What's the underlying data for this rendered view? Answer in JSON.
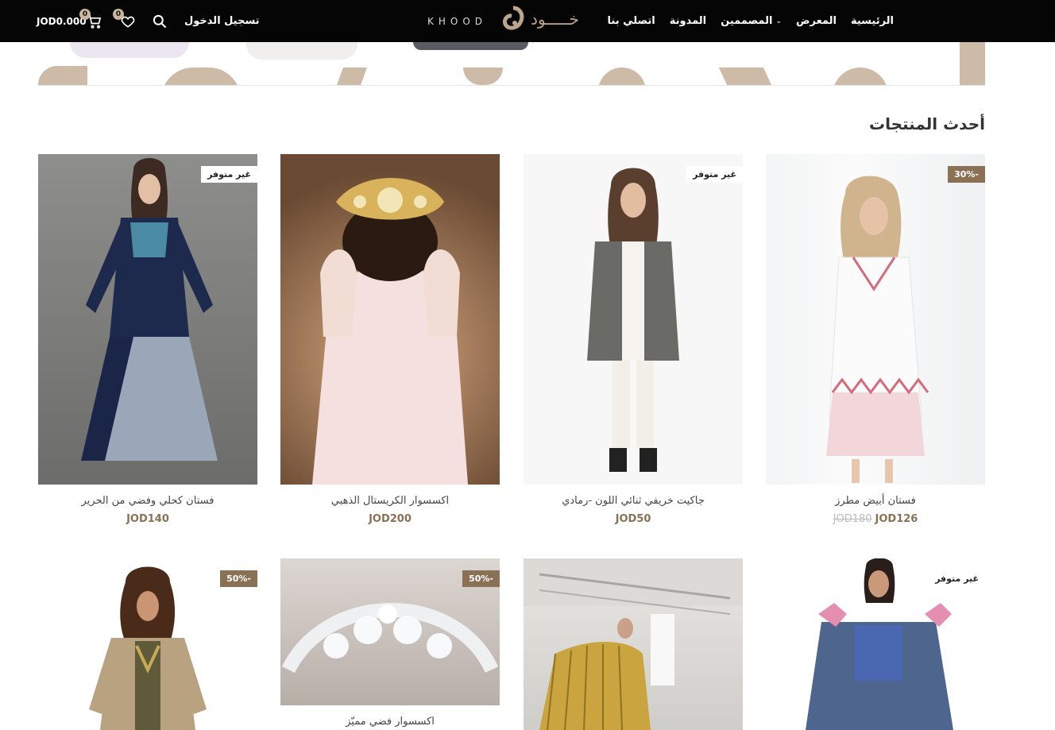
{
  "header": {
    "nav": [
      {
        "label": "الرئيسية",
        "has_dropdown": false
      },
      {
        "label": "المعرض",
        "has_dropdown": false
      },
      {
        "label": "المصممين",
        "has_dropdown": true
      },
      {
        "label": "المدونة",
        "has_dropdown": false
      },
      {
        "label": "اتصلي بنا",
        "has_dropdown": false
      }
    ],
    "logo_latin": "KHOOD",
    "logo_arabic": "خـــــود",
    "login_label": "تسجيل الدخول",
    "cart_total": "JOD0.000",
    "cart_count": "0",
    "wishlist_count": "0",
    "icons": {
      "search": "search-icon",
      "wishlist": "heart-icon",
      "cart": "cart-icon"
    }
  },
  "section": {
    "title": "أحدث المنتجات"
  },
  "colors": {
    "accent": "#8a7155",
    "topbar": "#050505",
    "banner_shape": "#cdbba8"
  },
  "products": [
    {
      "name": "فستان أبيض مطرز",
      "price": "JOD126",
      "old_price": "JOD180",
      "tag": "30%-",
      "tag_type": "sale"
    },
    {
      "name": "جاكيت خريفي ثنائي اللون -رمادي",
      "price": "JOD50",
      "old_price": "",
      "tag": "غير متوفر",
      "tag_type": "out"
    },
    {
      "name": "اكسسوار الكريستال الذهبي",
      "price": "JOD200",
      "old_price": "",
      "tag": "",
      "tag_type": ""
    },
    {
      "name": "فستان كحلي وفضي من الحرير",
      "price": "JOD140",
      "old_price": "",
      "tag": "غير متوفر",
      "tag_type": "out"
    },
    {
      "name": "",
      "price": "",
      "old_price": "",
      "tag": "غير متوفر",
      "tag_type": "out"
    },
    {
      "name": "",
      "price": "",
      "old_price": "",
      "tag": "",
      "tag_type": ""
    },
    {
      "name": "اكسسوار فضي مميّز",
      "price": "",
      "old_price": "",
      "tag": "50%-",
      "tag_type": "sale"
    },
    {
      "name": "",
      "price": "",
      "old_price": "",
      "tag": "50%-",
      "tag_type": "sale"
    }
  ]
}
